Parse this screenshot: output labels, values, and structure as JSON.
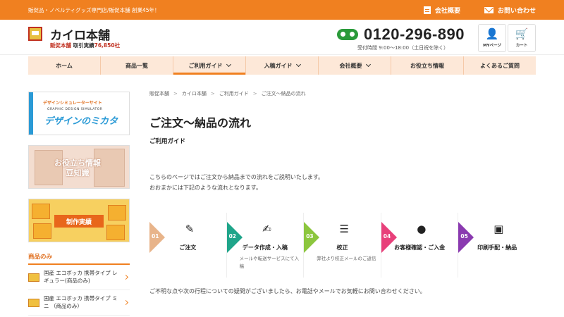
{
  "topbar": {
    "tagline": "販促品・ノベルティグッズ専門店/販促本舗 創業45年！",
    "links": [
      {
        "label": "会社概要",
        "icon": "building-icon"
      },
      {
        "label": "お問い合わせ",
        "icon": "mail-icon"
      }
    ]
  },
  "header": {
    "site_title": "カイロ本舗",
    "brand": "販促本舗",
    "record_label": "取引実績",
    "record_value": "76,850社",
    "phone": "0120-296-890",
    "hours": "受付時間 9:00～18:00（土日祝を除く）",
    "mypage_label": "MYページ",
    "cart_label": "カート"
  },
  "nav": {
    "items": [
      {
        "label": "ホーム",
        "dropdown": false
      },
      {
        "label": "商品一覧",
        "dropdown": false
      },
      {
        "label": "ご利用ガイド",
        "dropdown": true,
        "active": true
      },
      {
        "label": "入稿ガイド",
        "dropdown": true
      },
      {
        "label": "会社概要",
        "dropdown": true
      },
      {
        "label": "お役立ち情報",
        "dropdown": false
      },
      {
        "label": "よくあるご質問",
        "dropdown": false
      }
    ]
  },
  "sidebar": {
    "banner1": {
      "line1": "デザインシミュレーターサイト",
      "line2": "GRAPHIC DESIGN SIMULATOR",
      "line3": "デザインのミカタ"
    },
    "banner2": {
      "line1": "お役立ち情報",
      "line2": "豆知識"
    },
    "banner3": {
      "label": "制作実績"
    },
    "section_title": "商品のみ",
    "items": [
      {
        "label": "国産 エコボッカ 携帯タイプ レギュラー(商品のみ)"
      },
      {
        "label": "国産 エコボッカ 携帯タイプ ミニ （商品のみ）"
      }
    ]
  },
  "breadcrumb": [
    "販促本舗",
    "カイロ本舗",
    "ご利用ガイド",
    "ご注文〜納品の流れ"
  ],
  "page": {
    "title": "ご注文〜納品の流れ",
    "subtitle": "ご利用ガイド",
    "intro_line1": "こちらのページではご注文から納品までの流れをご説明いたします。",
    "intro_line2": "おおまかには下記のような流れとなります。",
    "note": "ご不明な点や次の行程についての疑問がございましたら、お電話やメールでお気軽にお問い合わせください。"
  },
  "steps": [
    {
      "num": "01",
      "title": "ご注文",
      "desc": "",
      "color": "#e8b48a",
      "icon": "edit-icon"
    },
    {
      "num": "02",
      "title": "データ作成・入稿",
      "desc": "メールや転送サービスにて入稿",
      "color": "#1fa58a",
      "icon": "pen-icon"
    },
    {
      "num": "03",
      "title": "校正",
      "desc": "弊社より校正メールのご返信",
      "color": "#8cc63e",
      "icon": "clipboard-icon"
    },
    {
      "num": "04",
      "title": "お客様確認・ご入金",
      "desc": "",
      "color": "#e8407a",
      "icon": "money-bag-icon"
    },
    {
      "num": "05",
      "title": "印刷手配・納品",
      "desc": "",
      "color": "#8a3ab0",
      "icon": "gift-icon"
    }
  ]
}
